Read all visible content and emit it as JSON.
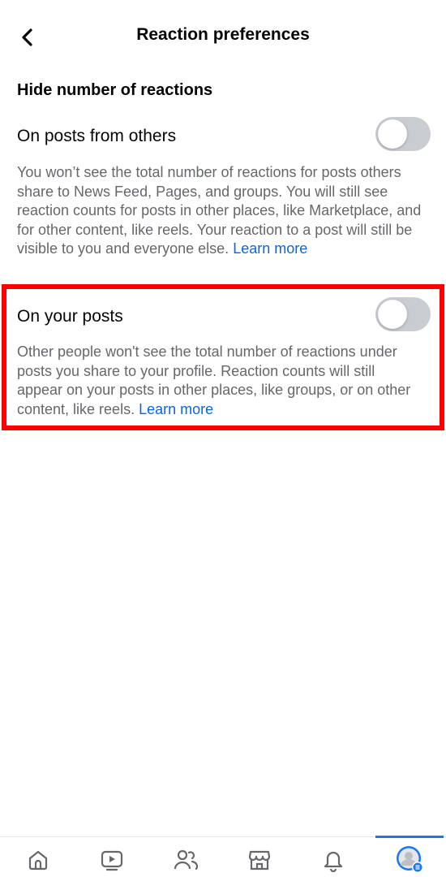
{
  "header": {
    "title": "Reaction preferences",
    "back_icon": "chevron-left-icon"
  },
  "section": {
    "heading": "Hide number of reactions"
  },
  "settings": [
    {
      "title": "On posts from others",
      "description": "You won’t see the total number of reactions for posts others share to News Feed, Pages, and groups. You will still see reaction counts for posts in other places, like Marketplace, and for other content, like reels. Your reaction to a post will still be visible to you and everyone else.",
      "learn_more": "Learn more",
      "enabled": false
    },
    {
      "title": "On your posts",
      "description": "Other people won't see the total number of reactions under posts you share to your profile. Reaction counts will still appear on your posts in other places, like groups, or on other content, like reels.",
      "learn_more": "Learn more",
      "enabled": false
    }
  ],
  "bottom_nav": {
    "items": [
      {
        "icon": "home-icon",
        "active": false
      },
      {
        "icon": "video-icon",
        "active": false
      },
      {
        "icon": "friends-icon",
        "active": false
      },
      {
        "icon": "marketplace-icon",
        "active": false
      },
      {
        "icon": "bell-icon",
        "active": false
      },
      {
        "icon": "profile-menu-icon",
        "active": true
      }
    ]
  },
  "colors": {
    "highlight": "#ff0000",
    "link": "#0a66d9",
    "toggle_off": "#c9ccd1",
    "accent": "#1877f2"
  }
}
